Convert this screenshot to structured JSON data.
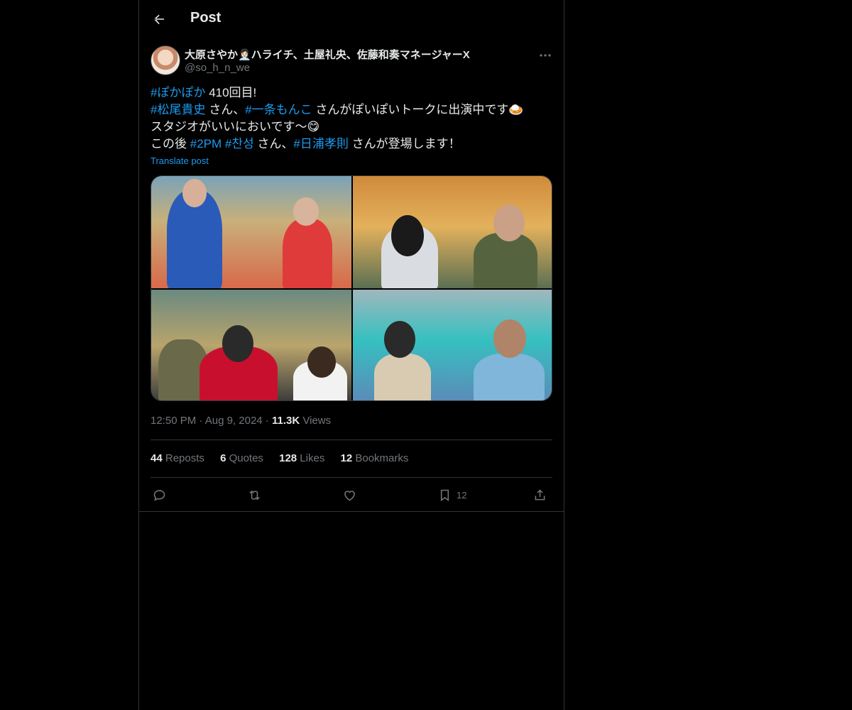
{
  "header": {
    "title": "Post"
  },
  "author": {
    "display_name": "大原さやか👩🏻‍💼ハライチ、土屋礼央、佐藤和奏マネージャーX",
    "handle": "@so_h_n_we"
  },
  "post": {
    "line1": {
      "tag1": "#ぽかぽか",
      "text1": " 410回目!"
    },
    "line2": {
      "tag1": "#松尾貴史",
      "text1": " さん、",
      "tag2": "#一条もんこ",
      "text2": " さんがぽいぽいトークに出演中です🍛"
    },
    "line3": {
      "text1": "スタジオがいいにおいです〜😋"
    },
    "line4": {
      "text1": "この後 ",
      "tag1": "#2PM",
      "sp": " ",
      "tag2": "#찬성",
      "text2": " さん、",
      "tag3": "#日浦孝則",
      "text3": " さんが登場します！"
    },
    "translate_label": "Translate post"
  },
  "meta": {
    "time": "12:50 PM",
    "sep1": " · ",
    "date": "Aug 9, 2024",
    "sep2": " · ",
    "views_count": "11.3K",
    "views_label": " Views"
  },
  "stats": {
    "reposts_count": "44",
    "reposts_label": " Reposts",
    "quotes_count": "6",
    "quotes_label": " Quotes",
    "likes_count": "128",
    "likes_label": " Likes",
    "bookmarks_count": "12",
    "bookmarks_label": " Bookmarks"
  },
  "actions": {
    "bookmark_count": "12"
  },
  "icons": [
    "back-arrow-icon",
    "more-icon",
    "reply-icon",
    "repost-icon",
    "like-icon",
    "bookmark-icon",
    "share-icon"
  ],
  "colors": {
    "background": "#000000",
    "text": "#e7e9ea",
    "muted": "#71767b",
    "link": "#1d9bf0",
    "border": "#2f3336"
  }
}
